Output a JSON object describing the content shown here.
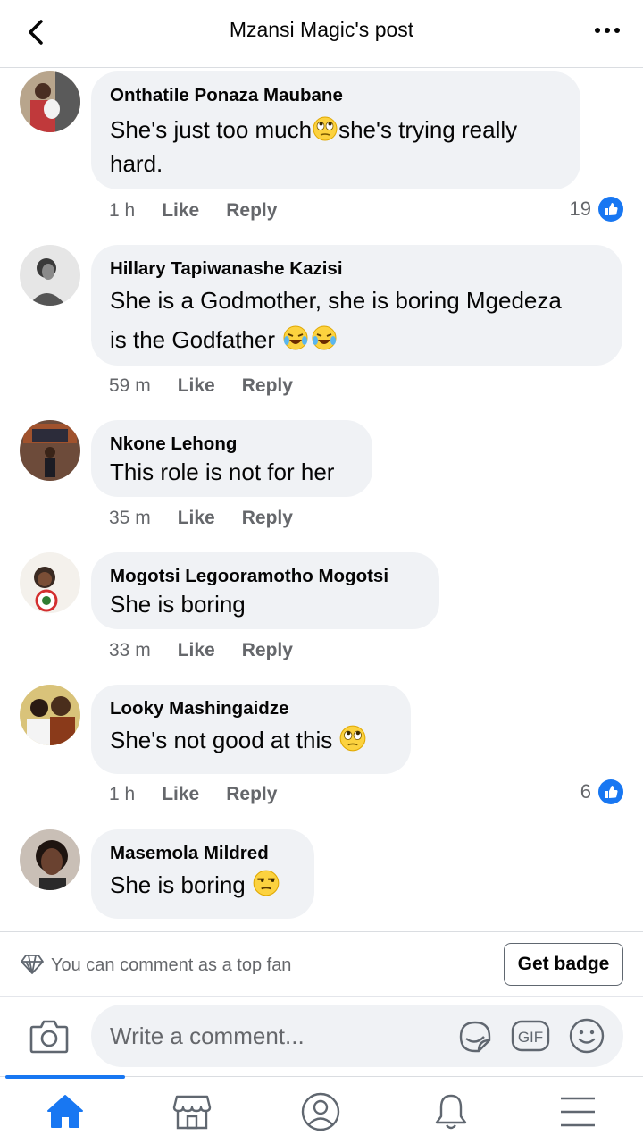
{
  "header": {
    "title": "Mzansi Magic's post"
  },
  "comments": [
    {
      "author": "Onthatile Ponaza Maubane",
      "text_lines": [
        "She's just too much",
        "she's trying really",
        "hard."
      ],
      "time": "1 h",
      "like": "Like",
      "reply": "Reply",
      "reactions": "19",
      "emoji": [
        "face-with-rolling-eyes"
      ]
    },
    {
      "author": "Hillary Tapiwanashe Kazisi",
      "text_lines": [
        "She is a Godmother, she is boring  Mgedeza",
        "is the Godfather"
      ],
      "time": "59 m",
      "like": "Like",
      "reply": "Reply",
      "emoji": [
        "rolling-on-floor-laughing",
        "rolling-on-floor-laughing"
      ]
    },
    {
      "author": "Nkone Lehong",
      "text_lines": [
        "This role is not for her"
      ],
      "time": "35 m",
      "like": "Like",
      "reply": "Reply"
    },
    {
      "author": "Mogotsi Legooramotho Mogotsi",
      "text_lines": [
        "She is boring"
      ],
      "time": "33 m",
      "like": "Like",
      "reply": "Reply"
    },
    {
      "author": "Looky Mashingaidze",
      "text_lines": [
        "She's not good at this"
      ],
      "time": "1 h",
      "like": "Like",
      "reply": "Reply",
      "reactions": "6",
      "emoji": [
        "face-with-rolling-eyes"
      ]
    },
    {
      "author": "Masemola Mildred",
      "text_lines": [
        "She is boring"
      ],
      "emoji": [
        "unamused-face"
      ]
    }
  ],
  "fanbar": {
    "text": "You can comment as a top fan",
    "button": "Get badge"
  },
  "composer": {
    "placeholder": "Write a comment...",
    "gif_label": "GIF"
  },
  "tabs": [
    "home-icon",
    "marketplace-icon",
    "profile-icon",
    "notifications-icon",
    "menu-icon"
  ],
  "colors": {
    "accent": "#1877f2",
    "bubble": "#f0f2f5",
    "secondary_text": "#65676b"
  }
}
